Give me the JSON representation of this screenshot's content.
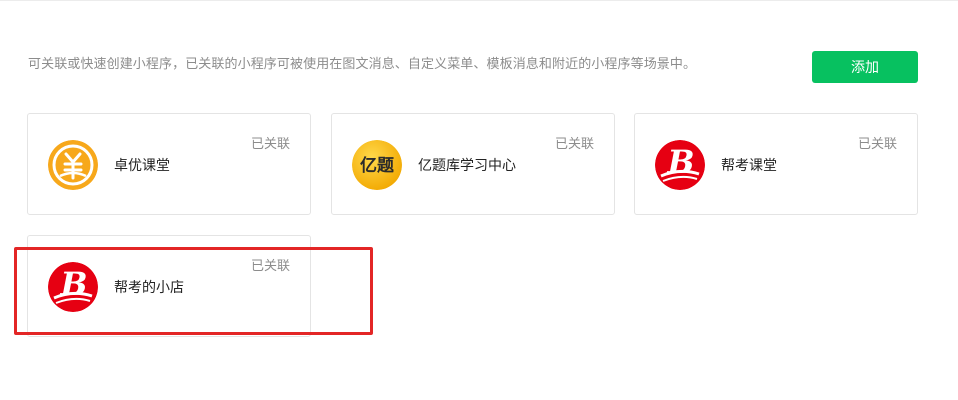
{
  "intro_text": "可关联或快速创建小程序，已关联的小程序可被使用在图文消息、自定义菜单、模板消息和附近的小程序等场景中。",
  "add_button_label": "添加",
  "colors": {
    "primary": "#07c160",
    "highlight": "#e32626"
  },
  "cards": [
    {
      "name": "卓优课堂",
      "status": "已关联",
      "icon": "zhuoyou-logo-icon"
    },
    {
      "name": "亿题库学习中心",
      "status": "已关联",
      "icon": "yiti-logo-icon",
      "logo_text": "亿题"
    },
    {
      "name": "帮考课堂",
      "status": "已关联",
      "icon": "bangkao-logo-icon"
    },
    {
      "name": "帮考的小店",
      "status": "已关联",
      "icon": "bangkao-logo-icon"
    }
  ]
}
